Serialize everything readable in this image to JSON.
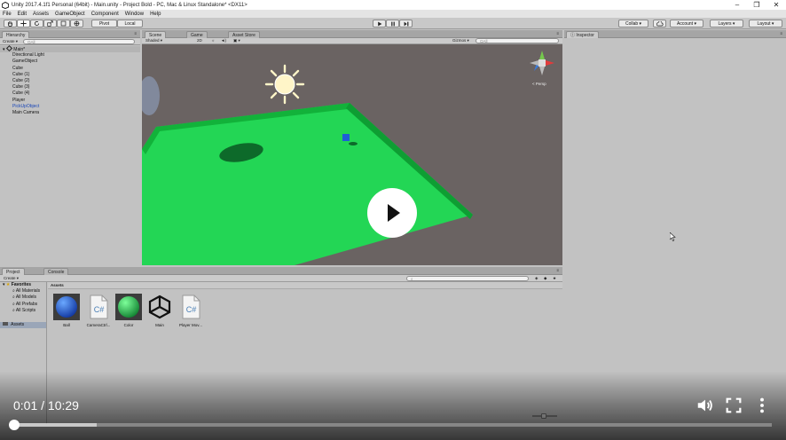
{
  "window": {
    "title": "Unity 2017.4.1f1 Personal (64bit) - Main.unity - Project Bold - PC, Mac & Linux Standalone* <DX11>",
    "controls": [
      "–",
      "❐",
      "✕"
    ]
  },
  "menu": [
    "File",
    "Edit",
    "Assets",
    "GameObject",
    "Component",
    "Window",
    "Help"
  ],
  "toolbar": {
    "pivot": "Pivot",
    "local": "Local",
    "collab": "Collab",
    "account": "Account",
    "layers": "Layers",
    "layout": "Layout"
  },
  "hierarchy": {
    "tab": "Hierarchy",
    "create": "Create",
    "search_placeholder": "QAll",
    "scene": "Main*",
    "items": [
      "Directional Light",
      "GameObject",
      "Cube",
      "Cube (1)",
      "Cube (2)",
      "Cube (3)",
      "Cube (4)",
      "Player",
      "PickUpObject",
      "Main Camera"
    ]
  },
  "scene_view": {
    "tabs": [
      "Scene",
      "Game",
      "Asset Store"
    ],
    "shading": "Shaded",
    "mode_2d": "2D",
    "gizmos": "Gizmos",
    "search_placeholder": "QAll",
    "gizmo_label": "< Persp"
  },
  "inspector": {
    "tab": "Inspector"
  },
  "project": {
    "tabs": [
      "Project",
      "Console"
    ],
    "create": "Create",
    "favorites": "Favorites",
    "fav_items": [
      "All Materials",
      "All Models",
      "All Prefabs",
      "All Scripts"
    ],
    "assets_root": "Assets",
    "breadcrumb": "Assets",
    "assets": [
      "Ball",
      "CameraCtrl...",
      "Color",
      "Main",
      "Player Mov..."
    ]
  },
  "video": {
    "current": "0:01",
    "duration": "10:29",
    "time_text": "0:01 / 10:29",
    "progress_fraction": 0.0016,
    "buffered_fraction": 0.11
  }
}
